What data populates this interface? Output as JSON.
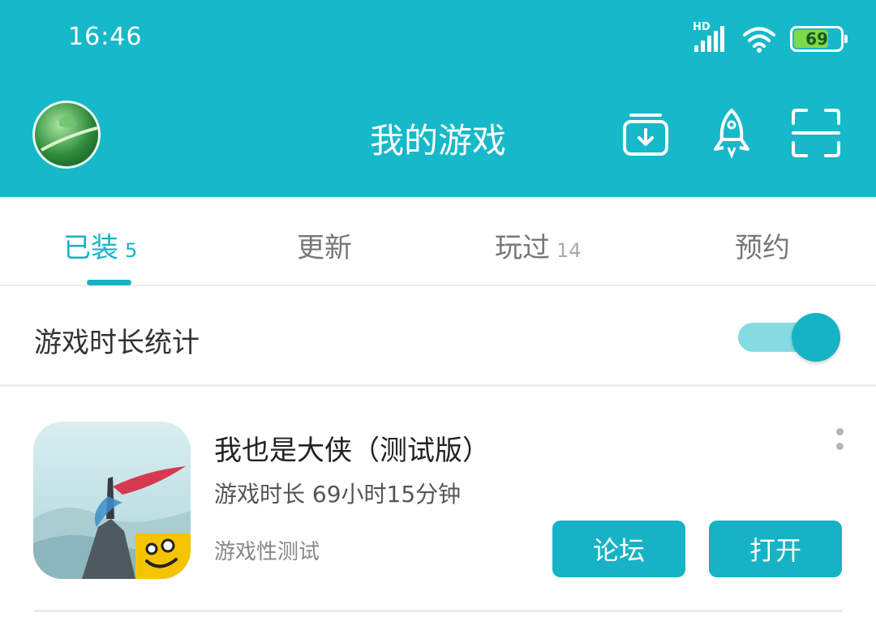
{
  "status_bar": {
    "time": "16:46",
    "signal_label": "HD",
    "battery": "69",
    "icons": [
      "signal-icon",
      "wifi-icon",
      "battery-icon"
    ]
  },
  "header": {
    "title": "我的游戏",
    "icons": [
      "download-icon",
      "rocket-icon",
      "scan-icon"
    ]
  },
  "tabs": [
    {
      "label": "已装",
      "count": "5"
    },
    {
      "label": "更新",
      "count": ""
    },
    {
      "label": "玩过",
      "count": "14"
    },
    {
      "label": "预约",
      "count": ""
    }
  ],
  "playtime_stats": {
    "label": "游戏时长统计",
    "enabled": true
  },
  "games": [
    {
      "name": "我也是大侠（测试版）",
      "playtime": "游戏时长 69小时15分钟",
      "tag": "游戏性测试",
      "forum_label": "论坛",
      "open_label": "打开"
    }
  ],
  "colors": {
    "accent": "#16b9c9",
    "toggle_track": "#86dbe3"
  }
}
